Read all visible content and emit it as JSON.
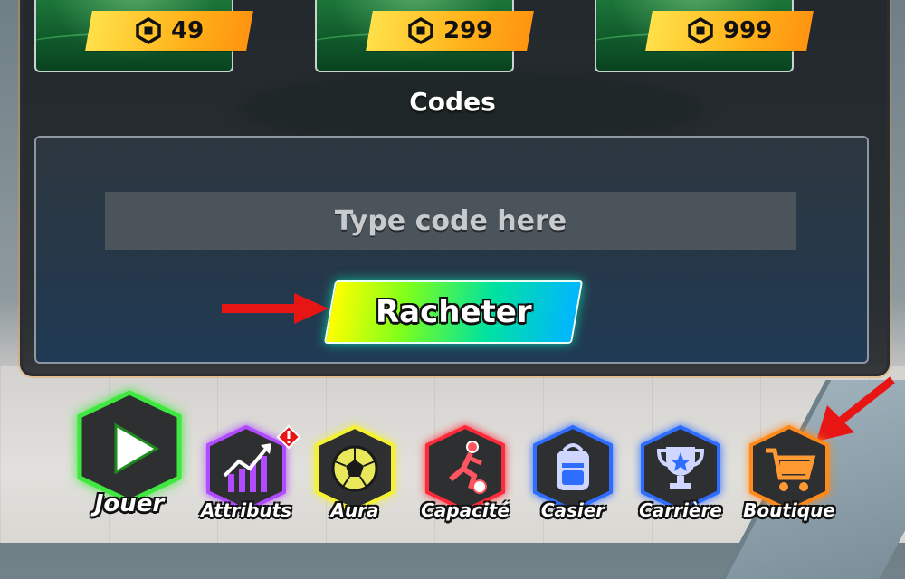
{
  "shop": {
    "items": [
      {
        "price": "49"
      },
      {
        "price": "299"
      },
      {
        "price": "999"
      }
    ]
  },
  "codes": {
    "title": "Codes",
    "input_placeholder": "Type code here",
    "redeem_label": "Racheter"
  },
  "nav": {
    "items": [
      {
        "label": "Jouer",
        "icon": "play-icon",
        "color": "#3ee83e"
      },
      {
        "label": "Attributs",
        "icon": "chart-up-icon",
        "color": "#b04bff",
        "badge": "!"
      },
      {
        "label": "Aura",
        "icon": "soccer-ball-icon",
        "color": "#f4f233"
      },
      {
        "label": "Capacité",
        "icon": "kick-player-icon",
        "color": "#ff2a3a"
      },
      {
        "label": "Casier",
        "icon": "backpack-icon",
        "color": "#2f6dff"
      },
      {
        "label": "Carrière",
        "icon": "trophy-icon",
        "color": "#2f6dff"
      },
      {
        "label": "Boutique",
        "icon": "cart-icon",
        "color": "#ff8a1a"
      }
    ]
  },
  "colors": {
    "panel": "#12161a",
    "price_tag": "#ffb21a",
    "arrow": "#e81515"
  }
}
